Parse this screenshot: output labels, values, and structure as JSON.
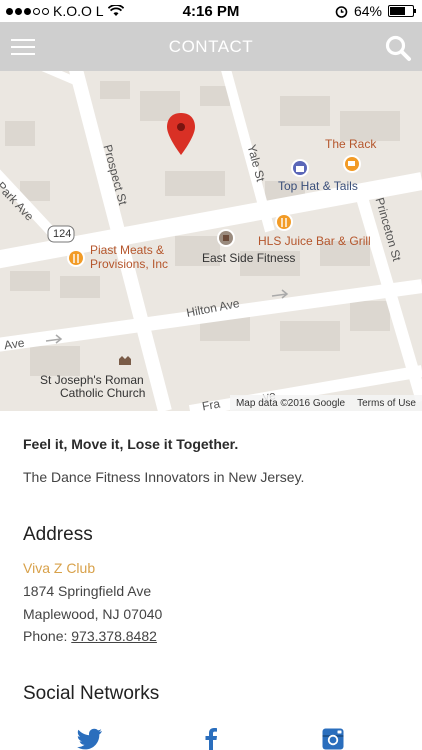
{
  "status": {
    "carrier": "K.O.O L",
    "time": "4:16 PM",
    "battery": "64%"
  },
  "nav": {
    "title": "CONTACT"
  },
  "map": {
    "streets": {
      "prospect": "Prospect St",
      "yale": "Yale St",
      "park": "Park Ave",
      "princeton": "Princeton St",
      "hilton": "Hilton Ave",
      "ave": "Ave",
      "frank": "Fra",
      "ave_tail": "ve",
      "route": "124"
    },
    "pois": {
      "the_rack": "The Rack",
      "top_hat": "Top Hat & Tails",
      "piast_1": "Piast Meats &",
      "piast_2": "Provisions, Inc",
      "hls": "HLS Juice Bar & Grill",
      "east_side": "East Side Fitness",
      "church_1": "St Joseph's Roman",
      "church_2": "Catholic Church"
    },
    "attribution": {
      "map_data": "Map data ©2016 Google",
      "terms": "Terms of Use"
    }
  },
  "info": {
    "tagline": "Feel it, Move it, Lose it Together.",
    "subtagline": "The Dance Fitness Innovators in New Jersey.",
    "address_heading": "Address",
    "club_name": "Viva Z Club",
    "street": "1874 Springfield Ave",
    "city": "Maplewood, NJ 07040",
    "phone_label": "Phone:",
    "phone_number": "973.378.8482",
    "social_heading": "Social Networks"
  },
  "colors": {
    "navbar": "#cfcfcf",
    "accent": "#d8a14a",
    "social_blue": "#2a6ebd",
    "pin_red": "#d93025"
  }
}
